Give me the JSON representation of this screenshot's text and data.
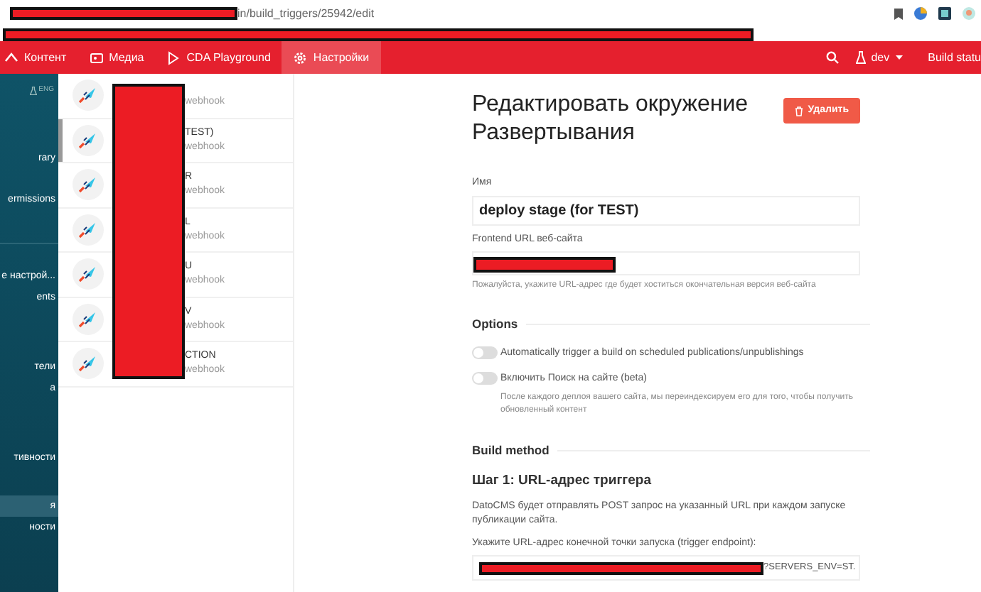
{
  "browser": {
    "url": "in/build_triggers/25942/edit"
  },
  "nav": {
    "tabs": [
      {
        "label": "Контент",
        "selected": false
      },
      {
        "label": "Медиа",
        "selected": false
      },
      {
        "label": "CDA Playground",
        "selected": false
      },
      {
        "label": "Настройки",
        "selected": true
      }
    ],
    "env": "dev",
    "build_status": "Build statu"
  },
  "sidebar": {
    "badge": "ENG",
    "sections": [
      {
        "items": [
          {
            "label": "rary",
            "selected": false
          },
          {
            "label": "ermissions",
            "selected": false
          }
        ]
      },
      {
        "items": [
          {
            "label": "е настрой...",
            "selected": false
          },
          {
            "label": "ents",
            "selected": false
          }
        ]
      },
      {
        "items": [
          {
            "label": "тели",
            "selected": false
          },
          {
            "label": "а",
            "selected": false
          }
        ]
      },
      {
        "items": [
          {
            "label": "тивности",
            "selected": false
          }
        ]
      },
      {
        "items": [
          {
            "label": "я",
            "selected": true
          },
          {
            "label": "ности",
            "selected": false
          }
        ]
      }
    ]
  },
  "triggers": [
    {
      "subtitle": "webhook",
      "selected": false
    },
    {
      "title": "TEST)",
      "subtitle": "webhook",
      "selected": true
    },
    {
      "title": "R",
      "subtitle": "webhook",
      "selected": false
    },
    {
      "title": "L",
      "subtitle": "webhook",
      "selected": false
    },
    {
      "title": "U",
      "subtitle": "webhook",
      "selected": false
    },
    {
      "title": "V",
      "subtitle": "webhook",
      "selected": false
    },
    {
      "title": "CTION",
      "subtitle": "webhook",
      "selected": false
    }
  ],
  "form": {
    "title": "Редактировать окружение Развертывания",
    "delete_button": "Удалить",
    "name_label": "Имя",
    "name_value": "deploy stage (for TEST)",
    "url_label": "Frontend URL веб-сайта",
    "url_help": "Пожалуйста, укажите URL-адрес где будет хоститься окончательная версия веб-сайта",
    "options_heading": "Options",
    "options": [
      {
        "label": "Automatically trigger a build on scheduled publications/unpublishings",
        "on": false
      },
      {
        "label": "Включить Поиск на сайте (beta)",
        "help": "После каждого деплоя вашего сайта, мы переиндексируем его для того, чтобы получить обновленный контент",
        "on": false
      }
    ],
    "build_heading": "Build method",
    "step_title": "Шаг 1: URL-адрес триггера",
    "step_text": "DatoCMS будет отправлять POST запрос на указанный URL при каждом запуске публикации сайта.",
    "endpoint_label": "Укажите URL-адрес конечной точки запуска (trigger endpoint):",
    "endpoint_value": "?SERVERS_ENV=ST."
  }
}
